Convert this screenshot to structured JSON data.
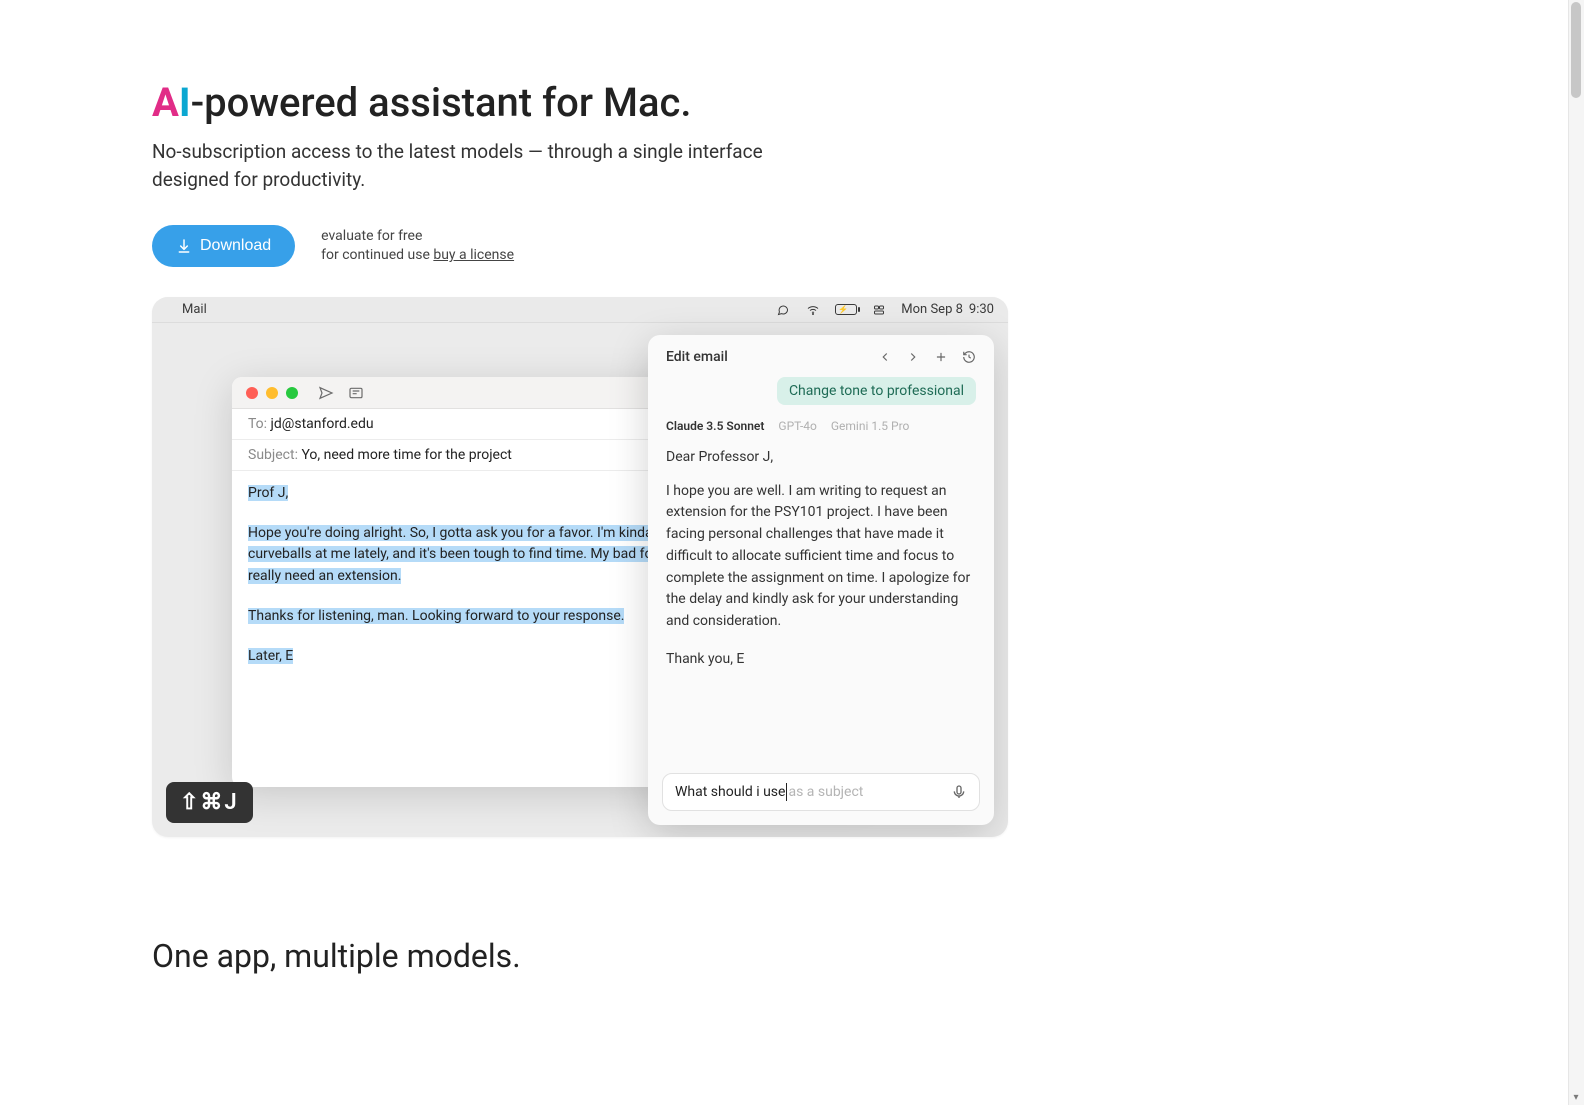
{
  "hero": {
    "title_prefix": "AI",
    "title_rest": "-powered assistant for Mac.",
    "subtitle": "No-subscription access to the latest models — through a single interface designed for productivity.",
    "download_label": "Download",
    "eval_line": "evaluate for free",
    "cont_prefix": "for continued use ",
    "license_link": "buy a license"
  },
  "menubar": {
    "app": "Mail",
    "date": "Mon Sep 8",
    "time": "9:30"
  },
  "mail": {
    "to_label": "To: ",
    "to_value": "jd@stanford.edu",
    "subject_label": "Subject: ",
    "subject_value": "Yo, need more time for the project",
    "body": {
      "greeting": "Prof J,",
      "p1": "Hope you're doing alright. So, I gotta ask you for a favor. I'm kinda struggling been throwing some curveballs at me lately, and it's been tough to find time. My bad for not being on top of it, but I really need an extension.",
      "p2": "Thanks for listening, man. Looking forward to your response.",
      "signoff": "Later, E"
    }
  },
  "shortcut": "⇧⌘J",
  "assistant": {
    "title": "Edit email",
    "chip": "Change tone to professional",
    "models": [
      "Claude 3.5 Sonnet",
      "GPT-4o",
      "Gemini 1.5 Pro"
    ],
    "response": {
      "greeting": "Dear Professor J,",
      "p1": "I hope you are well. I am writing to request an extension for the PSY101 project. I have been facing personal challenges that have made it difficult to allocate sufficient time and focus to complete the assignment on time. I apologize for the delay and kindly ask for your understanding and consideration.",
      "signoff": "Thank you, E"
    },
    "input_typed": "What should i use",
    "input_ghost": " as a subject"
  },
  "section2_heading": "One app, multiple models."
}
